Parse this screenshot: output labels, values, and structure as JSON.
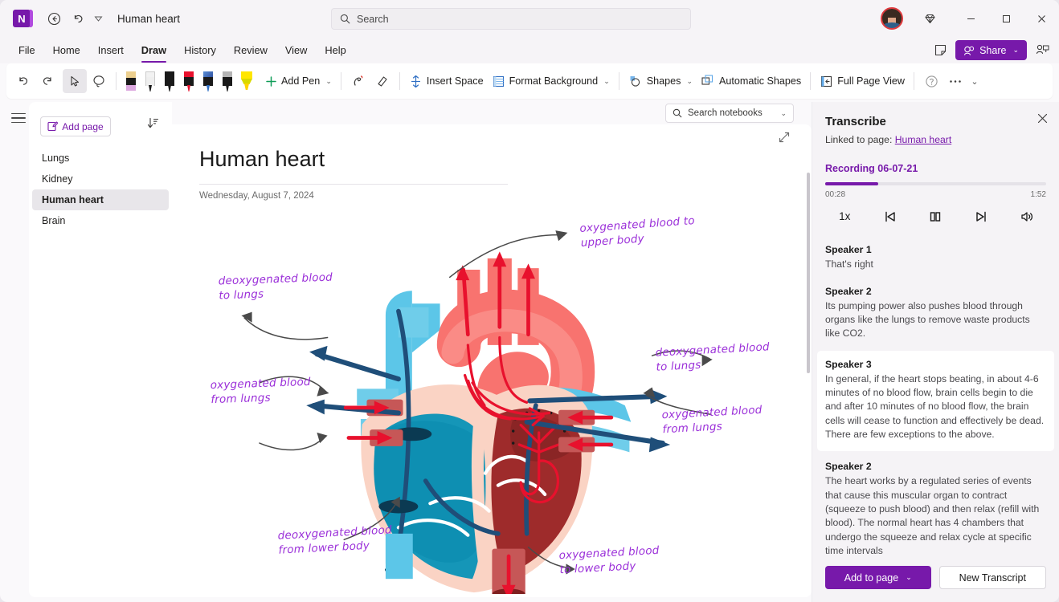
{
  "app": {
    "logo_letter": "N",
    "document_title": "Human heart"
  },
  "titlebar": {
    "back_icon": "back-circle-icon",
    "undo_icon": "undo-icon",
    "customize_icon": "customize-quick-access-icon",
    "search_placeholder": "Search",
    "search_icon": "search-icon",
    "diamond_icon": "diamond-icon",
    "minimize": "—",
    "maximize": "□",
    "close": "✕"
  },
  "menubar": {
    "items": [
      {
        "label": "File",
        "active": false
      },
      {
        "label": "Home",
        "active": false
      },
      {
        "label": "Insert",
        "active": false
      },
      {
        "label": "Draw",
        "active": true
      },
      {
        "label": "History",
        "active": false
      },
      {
        "label": "Review",
        "active": false
      },
      {
        "label": "View",
        "active": false
      },
      {
        "label": "Help",
        "active": false
      }
    ],
    "sticky_notes_icon": "sticky-note-icon",
    "share_label": "Share",
    "share_icon": "share-people-icon",
    "share_chevron": "⌄",
    "meeting_icon": "present-person-icon"
  },
  "ribbon": {
    "undo_icon": "undo-icon",
    "redo_icon": "redo-icon",
    "select_icon": "select-cursor-icon",
    "lasso_icon": "lasso-select-icon",
    "pens": [
      {
        "name": "eraser-pencil",
        "cap": "#eccf8e",
        "tip": "#dda9e0",
        "kind": "erase"
      },
      {
        "name": "pen-white",
        "cap": "#f2f2f2",
        "tip": "#d6d6d6",
        "kind": "pen"
      },
      {
        "name": "pen-black",
        "cap": "#1a1a1a",
        "tip": "#1a1a1a",
        "kind": "pen"
      },
      {
        "name": "pen-red",
        "cap": "#e8112d",
        "tip": "#e8112d",
        "kind": "pen"
      },
      {
        "name": "pen-blue",
        "cap": "#2f6fc4",
        "tip": "#2f6fc4",
        "kind": "pen"
      },
      {
        "name": "pen-gray",
        "cap": "#b5b5b5",
        "tip": "#9a9a9a",
        "kind": "pen"
      },
      {
        "name": "highlighter-yellow",
        "cap": "#ffe600",
        "tip": "#ffd400",
        "kind": "hl"
      }
    ],
    "add_pen_label": "Add Pen",
    "add_pen_icon": "plus-icon",
    "ink_to_shape_icon": "ink-to-shape-icon",
    "eraser_icon": "eraser-icon",
    "insert_space_label": "Insert Space",
    "insert_space_icon": "insert-space-icon",
    "format_background_label": "Format Background",
    "format_background_icon": "format-background-icon",
    "shapes_label": "Shapes",
    "shapes_icon": "shapes-icon",
    "automatic_shapes_label": "Automatic Shapes",
    "automatic_shapes_icon": "automatic-shapes-icon",
    "full_page_view_label": "Full Page View",
    "full_page_view_icon": "full-page-view-icon",
    "help_icon": "help-circle-icon",
    "overflow_icon": "more-ellipsis-icon",
    "collapse_chevron": "⌄",
    "dropdown_chevron": "⌄"
  },
  "sidebar": {
    "nav_toggle_icon": "hamburger-menu-icon",
    "add_page_label": "Add page",
    "add_page_icon": "add-page-pencil-icon",
    "sort_icon": "sort-pages-icon",
    "pages": [
      {
        "label": "Lungs",
        "active": false
      },
      {
        "label": "Kidney",
        "active": false
      },
      {
        "label": "Human heart",
        "active": true
      },
      {
        "label": "Brain",
        "active": false
      }
    ]
  },
  "canvas": {
    "notebook_search_placeholder": "Search notebooks",
    "notebook_search_icon": "search-icon",
    "notebook_search_chevron": "⌄",
    "expand_icon": "expand-diagonal-icon",
    "page_title": "Human heart",
    "page_date": "Wednesday, August 7, 2024",
    "ink_annotations": [
      {
        "name": "ink-oxygenated-to-upper-body",
        "text": "oxygenated blood to\nupper body"
      },
      {
        "name": "ink-deoxygenated-to-lungs-left",
        "text": "deoxygenated blood\nto lungs"
      },
      {
        "name": "ink-oxygenated-from-lungs-left",
        "text": "oxygenated blood\nfrom lungs"
      },
      {
        "name": "ink-deoxygenated-to-lungs-right",
        "text": "deoxygenated blood\nto lungs"
      },
      {
        "name": "ink-oxygenated-from-lungs-right",
        "text": "oxygenated blood\nfrom lungs"
      },
      {
        "name": "ink-deoxygenated-from-lower-body",
        "text": "deoxygenated blood\nfrom lower body"
      },
      {
        "name": "ink-oxygenated-to-lower-body",
        "text": "oxygenated blood\nto lower body"
      }
    ],
    "ink_color": "#9b30d9"
  },
  "transcribe": {
    "title": "Transcribe",
    "close_icon": "close-icon",
    "linked_prefix": "Linked to page:",
    "linked_page": "Human heart",
    "recording_name": "Recording 06-07-21",
    "elapsed_time": "00:28",
    "total_time": "1:52",
    "progress_percent": 24,
    "accent_color": "#7719aa",
    "controls": [
      {
        "name": "playback-speed-button",
        "label": "1x"
      },
      {
        "name": "previous-button",
        "label": "previous-icon"
      },
      {
        "name": "pause-button",
        "label": "pause-icon"
      },
      {
        "name": "next-button",
        "label": "next-icon"
      },
      {
        "name": "volume-button",
        "label": "volume-icon"
      }
    ],
    "entries": [
      {
        "speaker": "Speaker 1",
        "text": "That's right",
        "highlighted": false
      },
      {
        "speaker": "Speaker 2",
        "text": "Its pumping power also pushes blood through organs like the lungs to remove waste products like CO2.",
        "highlighted": false
      },
      {
        "speaker": "Speaker 3",
        "text": "In general, if the heart stops beating, in about 4-6 minutes of no blood flow, brain cells begin to die and after 10 minutes of no blood flow, the brain cells will cease to function and effectively be dead. There are few exceptions to the above.",
        "highlighted": true
      },
      {
        "speaker": "Speaker 2",
        "text": "The heart works by a regulated series of events that cause this muscular organ to contract (squeeze to push blood) and then relax (refill with blood). The normal heart has 4 chambers that undergo the squeeze and relax cycle at specific time intervals",
        "highlighted": false
      }
    ],
    "add_to_page_label": "Add to page",
    "add_to_page_chevron": "⌄",
    "new_transcript_label": "New Transcript"
  }
}
